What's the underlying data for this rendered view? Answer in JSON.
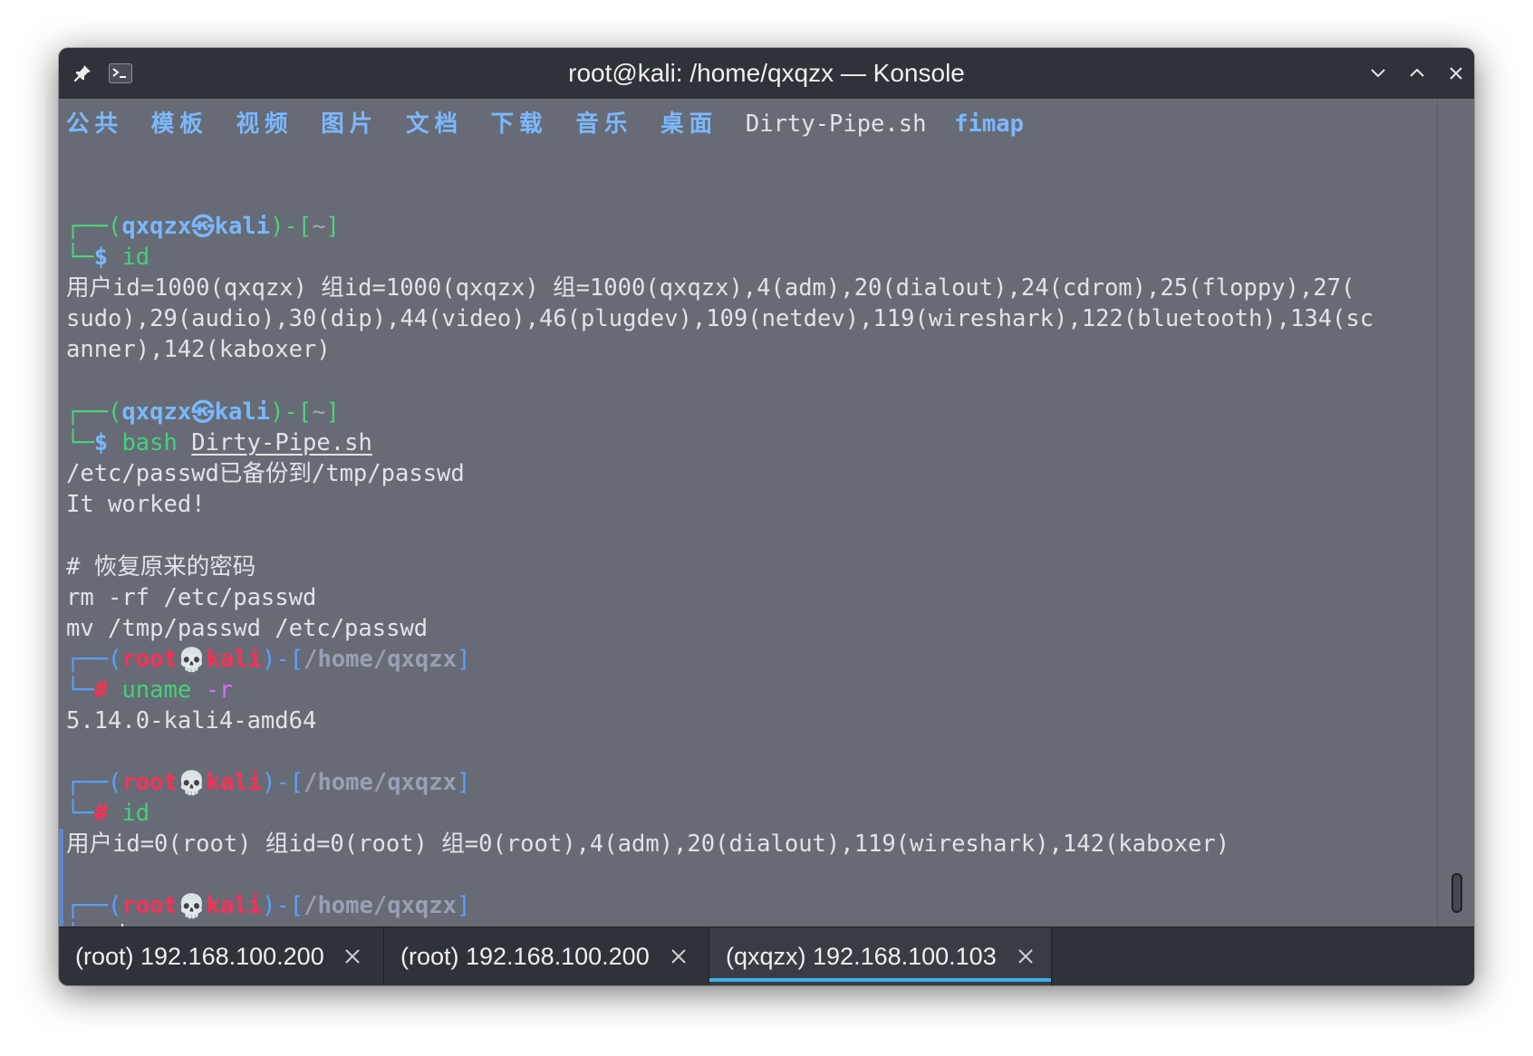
{
  "window": {
    "title": "root@kali: /home/qxqzx — Konsole"
  },
  "listing": {
    "dirs": [
      "公共",
      "模板",
      "视频",
      "图片",
      "文档",
      "下载",
      "音乐",
      "桌面"
    ],
    "file": "Dirty-Pipe.sh",
    "exec": "fimap"
  },
  "prompt_user": {
    "user": "qxqzx",
    "host": "kali",
    "cwd": "~",
    "symbol": "$"
  },
  "prompt_root": {
    "user": "root",
    "host": "kali",
    "cwd": "/home/qxqzx",
    "symbol": "#"
  },
  "commands": {
    "c1": "id",
    "c2_cmd": "bash",
    "c2_arg": "Dirty-Pipe.sh",
    "c3_cmd": "uname",
    "c3_arg": "-r",
    "c4": "id"
  },
  "output": {
    "id_user_1": "用户id=1000(qxqzx) 组id=1000(qxqzx) 组=1000(qxqzx),4(adm),20(dialout),24(cdrom),25(floppy),27(",
    "id_user_2": "sudo),29(audio),30(dip),44(video),46(plugdev),109(netdev),119(wireshark),122(bluetooth),134(sc",
    "id_user_3": "anner),142(kaboxer)",
    "backup": "/etc/passwd已备份到/tmp/passwd",
    "worked": "It worked!",
    "comment": "# 恢复原来的密码",
    "rm": "rm -rf /etc/passwd",
    "mv": "mv /tmp/passwd /etc/passwd",
    "uname": "5.14.0-kali4-amd64",
    "id_root": "用户id=0(root) 组id=0(root) 组=0(root),4(adm),20(dialout),119(wireshark),142(kaboxer)"
  },
  "tabs": [
    {
      "label": "(root) 192.168.100.200"
    },
    {
      "label": "(root) 192.168.100.200"
    },
    {
      "label": "(qxqzx) 192.168.100.103"
    }
  ],
  "icons": {
    "pin": "pin-icon",
    "terminal": "terminal-icon",
    "minimize": "chevron-down-icon",
    "maximize": "chevron-up-icon",
    "close": "close-icon",
    "tab_close": "close-icon"
  },
  "colors": {
    "terminal_bg": "#676b75",
    "titlebar_bg": "#2f3238",
    "prompt_green": "#4bd37a",
    "prompt_blue": "#78b8ff",
    "root_red": "#ff2f55",
    "tab_accent": "#3daee9"
  }
}
